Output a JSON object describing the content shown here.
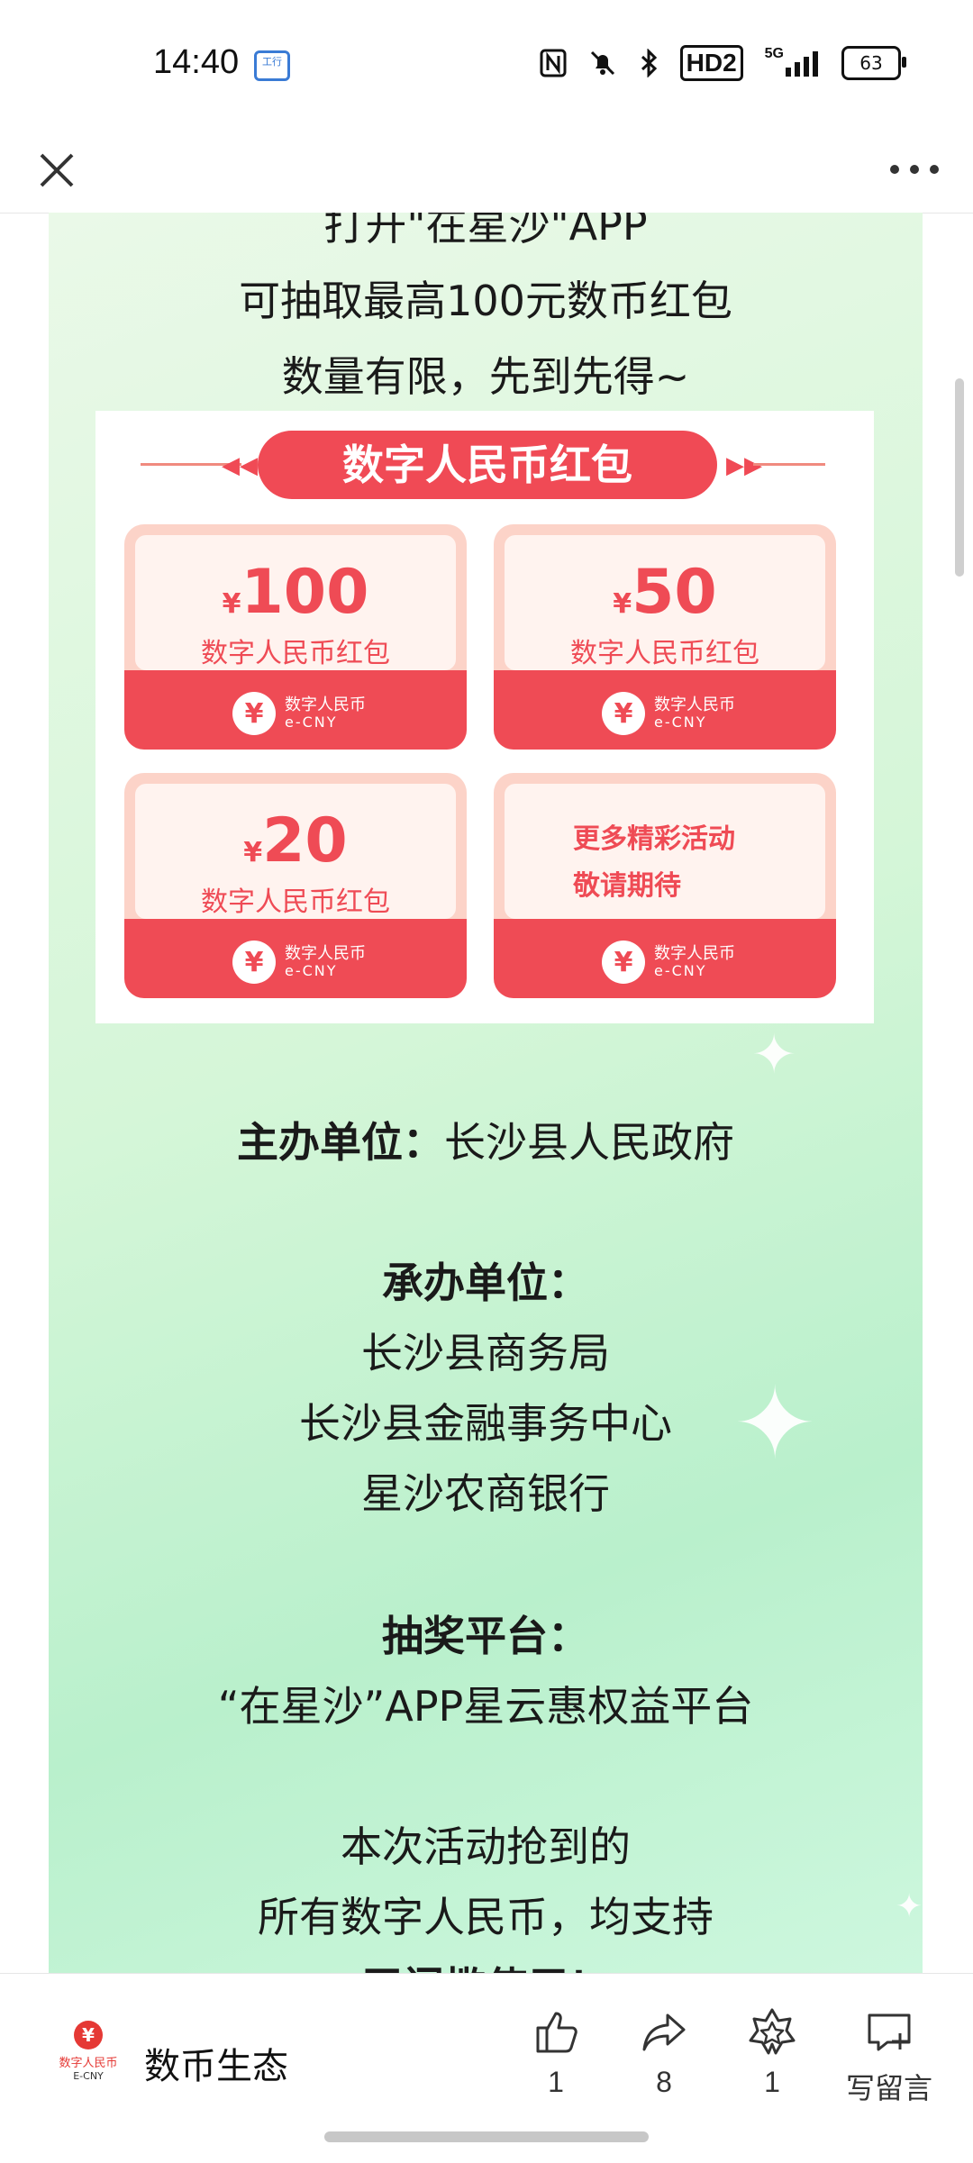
{
  "status_bar": {
    "time": "14:40",
    "app_badge": "工行",
    "network": "5G",
    "hd_label": "HD2",
    "battery": "63"
  },
  "content": {
    "intro_lines": [
      "打开\"在星沙\"APP",
      "可抽取最高100元数币红包",
      "数量有限，先到先得~"
    ],
    "promo": {
      "banner": "数字人民币红包",
      "cards": [
        {
          "amount": "100",
          "currency": "¥",
          "label": "数字人民币红包"
        },
        {
          "amount": "50",
          "currency": "¥",
          "label": "数字人民币红包"
        },
        {
          "amount": "20",
          "currency": "¥",
          "label": "数字人民币红包"
        },
        {
          "more_line1": "更多精彩活动",
          "more_line2": "敬请期待"
        }
      ],
      "card_footer_cn": "数字人民币",
      "card_footer_en": "e-CNY"
    },
    "host_label": "主办单位：",
    "host_value": "长沙县人民政府",
    "organizer_label": "承办单位：",
    "organizers": [
      "长沙县商务局",
      "长沙县金融事务中心",
      "星沙农商银行"
    ],
    "platform_label": "抽奖平台：",
    "platform_value": "“在星沙”APP星云惠权益平台",
    "footer_lines": [
      "本次活动抢到的",
      "所有数字人民币，均支持",
      "无门槛使用！"
    ]
  },
  "bottom_bar": {
    "brand_logo_cn": "数字人民币",
    "brand_logo_en": "E-CNY",
    "brand_name": "数币生态",
    "like_count": "1",
    "share_count": "8",
    "favorite_count": "1",
    "comment_label": "写留言"
  },
  "colors": {
    "accent_red": "#ef4b55",
    "background_green": "#c9f2d6"
  }
}
